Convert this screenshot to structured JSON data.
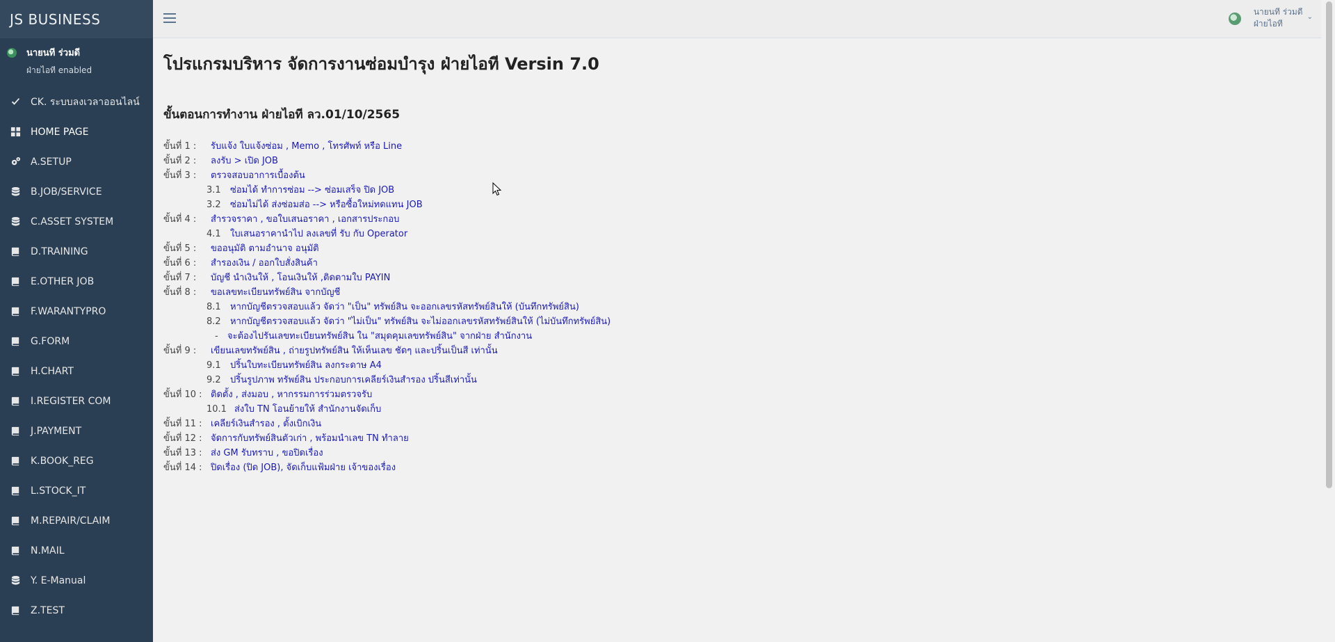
{
  "brand": "JS  BUSINESS",
  "profile": {
    "name": "นายนที ร่วมดี",
    "role": "ฝ่ายไอที enabled"
  },
  "menu": [
    {
      "label": "CK. ระบบลงเวลาออนไลน์",
      "icon": "check-icon"
    },
    {
      "label": "HOME PAGE",
      "icon": "dashboard-icon"
    },
    {
      "label": "A.SETUP",
      "icon": "gears-icon"
    },
    {
      "label": "B.JOB/SERVICE",
      "icon": "database-icon"
    },
    {
      "label": "C.ASSET SYSTEM",
      "icon": "database-icon"
    },
    {
      "label": "D.TRAINING",
      "icon": "book-icon"
    },
    {
      "label": "E.OTHER JOB",
      "icon": "book-icon"
    },
    {
      "label": "F.WARANTYPRO",
      "icon": "book-icon"
    },
    {
      "label": "G.FORM",
      "icon": "book-icon"
    },
    {
      "label": "H.CHART",
      "icon": "book-icon"
    },
    {
      "label": "I.REGISTER COM",
      "icon": "book-icon"
    },
    {
      "label": "J.PAYMENT",
      "icon": "book-icon"
    },
    {
      "label": "K.BOOK_REG",
      "icon": "book-icon"
    },
    {
      "label": "L.STOCK_IT",
      "icon": "book-icon"
    },
    {
      "label": "M.REPAIR/CLAIM",
      "icon": "book-icon"
    },
    {
      "label": "N.MAIL",
      "icon": "book-icon"
    },
    {
      "label": "Y. E-Manual",
      "icon": "database-icon"
    },
    {
      "label": "Z.TEST",
      "icon": "book-icon"
    }
  ],
  "topbar": {
    "user_name": "นายนที ร่วมดี",
    "user_dept": "ฝ่ายไอที",
    "chevron": "⌄"
  },
  "main": {
    "title": "โปรแกรมบริหาร จัดการงานซ่อมบำรุง ฝ่ายไอที Versin 7.0",
    "section": "ขั้นตอนการทำงาน ฝ่ายไอที ลว.01/10/2565",
    "steps": [
      {
        "label": "ขั้นที่ 1 :",
        "text": "รับแจ้ง ใบแจ้งซ่อม , Memo , โทรศัพท์ หรือ Line"
      },
      {
        "label": "ขั้นที่ 2 :",
        "text": "ลงรับ > เปิด JOB"
      },
      {
        "label": "ขั้นที่ 3 :",
        "text": "ตรวจสอบอาการเบื้องต้น"
      },
      {
        "sub": "3.1",
        "text": "ซ่อมได้ ทำการซ่อม --> ซ่อมเสร็จ ปิด JOB"
      },
      {
        "sub": "3.2",
        "text": "ซ่อมไม่ได้ ส่งซ่อมส่อ --> หรือซื้อใหม่ทดแทน JOB"
      },
      {
        "label": "ขั้นที่ 4 :",
        "text": "สำรวจราคา , ขอใบเสนอราคา , เอกสารประกอบ"
      },
      {
        "sub": "4.1",
        "text": "ใบเสนอราคานำไป ลงเลขที่ รับ กับ Operator"
      },
      {
        "label": "ขั้นที่ 5 :",
        "text": "ขออนุมัติ ตามอำนาจ อนุมัติ"
      },
      {
        "label": "ขั้นที่ 6 :",
        "text": "สำรองเงิน / ออกใบสั่งสินค้า"
      },
      {
        "label": "ขั้นที่ 7 :",
        "text": "บัญชี นำเงินให้ , โอนเงินให้ ,ติดตามใบ PAYIN"
      },
      {
        "label": "ขั้นที่ 8 :",
        "text": "ขอเลขทะเบียนทรัพย์สิน จากบัญชี"
      },
      {
        "sub": "8.1",
        "text": "หากบัญชีตรวจสอบแล้ว จัดว่า \"เป็น\" ทรัพย์สิน จะออกเลขรหัสทรัพย์สินให้ (บันทึกทรัพย์สิน)"
      },
      {
        "sub": "8.2",
        "text": "หากบัญชีตรวจสอบแล้ว จัดว่า \"ไม่เป็น\" ทรัพย์สิน จะไม่ออกเลขรหัสทรัพย์สินให้ (ไม่บันทึกทรัพย์สิน)"
      },
      {
        "sub": "-",
        "text": "จะต้องไปรันเลขทะเบียนทรัพย์สิน ใน \"สมุดคุมเลขทรัพย์สิน\" จากฝ่าย สำนักงาน"
      },
      {
        "label": "ขั้นที่ 9 :",
        "text": "เขียนเลขทรัพย์สิน , ถ่ายรูปทรัพย์สิน ให้เห็นเลข ชัดๆ และปริ้นเป็นสี เท่านั้น"
      },
      {
        "sub": "9.1",
        "text": "ปริ้นใบทะเบียนทรัพย์สิน ลงกระดาษ A4"
      },
      {
        "sub": "9.2",
        "text": "ปริ้นรูปภาพ ทรัพย์สิน ประกอบการเคลียร์เงินสำรอง ปริ้นสีเท่านั้น"
      },
      {
        "label": "ขั้นที่ 10 :",
        "text": "ติดตั้ง , ส่งมอบ , หากรรมการร่วมตรวจรับ"
      },
      {
        "sub": "10.1",
        "text": "ส่งใบ TN โอนย้ายให้ สำนักงานจัดเก็บ"
      },
      {
        "label": "ขั้นที่ 11 :",
        "text": "เคลียร์เงินสำรอง , ตั้งเบิกเงิน"
      },
      {
        "label": "ขั้นที่ 12 :",
        "text": "จัดการกับทรัพย์สินตัวเก่า , พร้อมนำเลข TN ทำลาย"
      },
      {
        "label": "ขั้นที่ 13 :",
        "text": "ส่ง GM รับทราบ , ขอปิดเรื่อง"
      },
      {
        "label": "ขั้นที่ 14 :",
        "text": "ปิดเรื่อง (ปิด JOB), จัดเก็บแฟ้มฝ่าย เจ้าของเรื่อง"
      }
    ]
  }
}
